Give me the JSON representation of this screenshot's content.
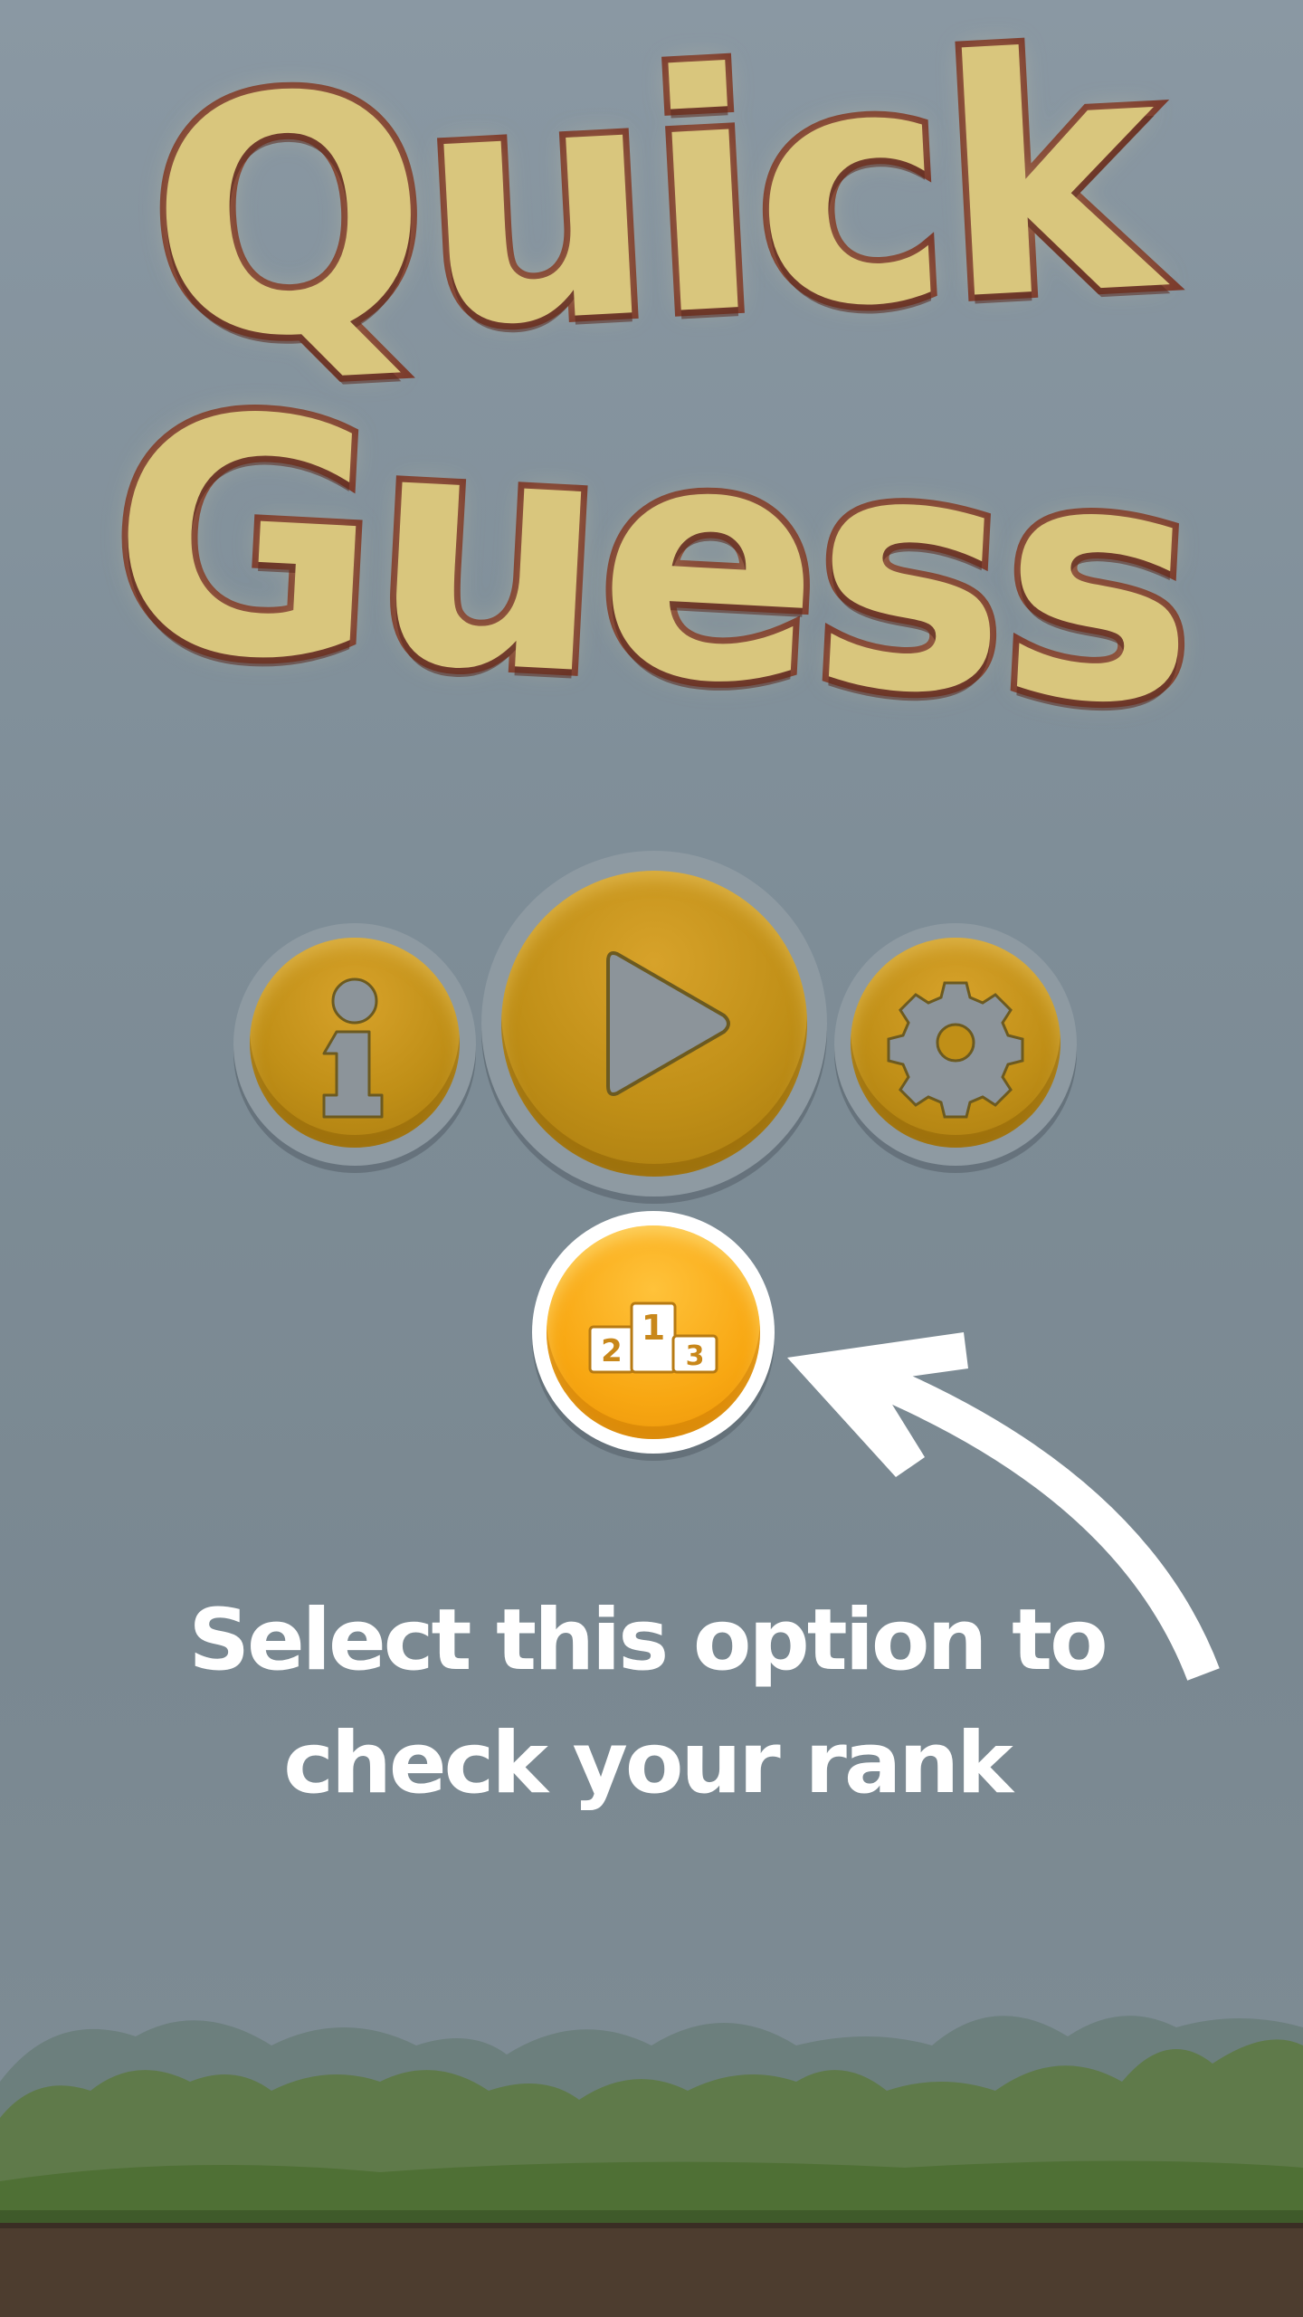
{
  "title": {
    "line1": "Quick",
    "line2": "Guess"
  },
  "menu": {
    "info_icon": "info-icon",
    "play_icon": "play-icon",
    "settings_icon": "gear-icon",
    "rank_icon": "podium-icon",
    "podium_numbers": [
      "2",
      "1",
      "3"
    ]
  },
  "hint": {
    "text": "Select this option to check your rank",
    "arrow_icon": "curved-arrow-icon"
  },
  "colors": {
    "button_dim": "#c08f17",
    "button_active": "#f8a712",
    "title_fill": "#d9c67d",
    "title_outline": "#7a3a2c",
    "overlay": "#7e8d97"
  }
}
